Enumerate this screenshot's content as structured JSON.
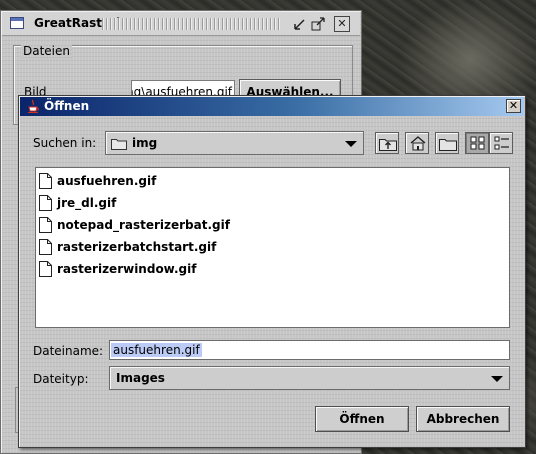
{
  "background_window": {
    "title": "GreatRasterizer",
    "section_label": "Dateien",
    "bild_label": "Bild",
    "bild_value": "mg\\ausfuehren.gif",
    "browse_button": "Auswählen..."
  },
  "dialog": {
    "title": "Öffnen",
    "look_in_label": "Suchen in:",
    "look_in_value": "img",
    "files": [
      "ausfuehren.gif",
      "jre_dl.gif",
      "notepad_rasterizerbat.gif",
      "rasterizerbatchstart.gif",
      "rasterizerwindow.gif"
    ],
    "filename_label": "Dateiname:",
    "filename_value": "ausfuehren.gif",
    "filetype_label": "Dateityp:",
    "filetype_value": "Images",
    "open_button": "Öffnen",
    "cancel_button": "Abbrechen"
  },
  "colors": {
    "title_active_start": "#0a246a",
    "title_active_end": "#a6caf0",
    "selection": "#bccbf5"
  }
}
